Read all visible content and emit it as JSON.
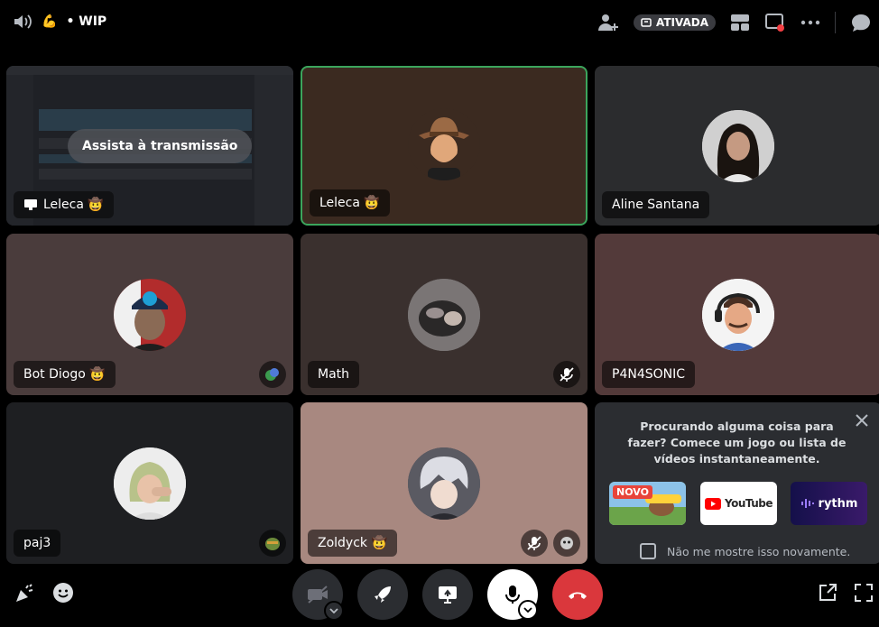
{
  "topbar": {
    "channel_emoji": "💪",
    "channel_name": "• WIP",
    "activity_badge": "ATIVADA"
  },
  "stream_tile": {
    "overlay_button": "Assista à transmissão",
    "name": "Leleca 🤠"
  },
  "participants": [
    {
      "id": "leleca",
      "name": "Leleca 🤠",
      "speaking": true
    },
    {
      "id": "aline",
      "name": "Aline Santana"
    },
    {
      "id": "diogo",
      "name": "Bot Diogo 🤠"
    },
    {
      "id": "math",
      "name": "Math",
      "muted": true
    },
    {
      "id": "p4n4sonic",
      "name": "P4N4SONIC"
    },
    {
      "id": "paj3",
      "name": "paj3"
    },
    {
      "id": "zoldyck",
      "name": "Zoldyck 🤠",
      "muted": true
    }
  ],
  "promo": {
    "text": "Procurando alguma coisa para fazer? Comece um jogo ou lista de vídeos instantaneamente.",
    "apps": [
      {
        "id": "farm",
        "label": "NOVO"
      },
      {
        "id": "youtube",
        "label": "YouTube"
      },
      {
        "id": "rythm",
        "label": "rythm"
      }
    ],
    "checkbox_label": "Não me mostre isso novamente."
  },
  "colors": {
    "speaking_border": "#3ba55c",
    "hangup": "#da373c",
    "mic_active": "#ffffff",
    "control_bg": "#2b2d31"
  },
  "icons": [
    "volume-icon",
    "add-user-icon",
    "grid-icon",
    "screen-icon",
    "more-icon",
    "chat-icon",
    "soundboard-icon",
    "emoji-icon",
    "camera-off-icon",
    "rocket-icon",
    "screenshare-icon",
    "mic-icon",
    "hangup-icon",
    "popout-icon",
    "fullscreen-icon"
  ]
}
